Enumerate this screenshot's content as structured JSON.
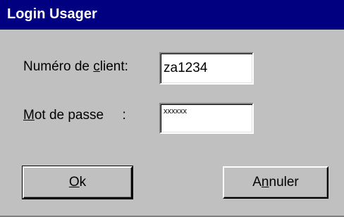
{
  "dialog": {
    "title": "Login Usager"
  },
  "form": {
    "client_label_before": "Numéro de ",
    "client_label_mnemonic": "c",
    "client_label_after": "lient:",
    "client_value": "za1234",
    "password_label_mnemonic": "M",
    "password_label_after": "ot de passe     :",
    "password_value": "xxxxxx"
  },
  "buttons": {
    "ok_mnemonic": "O",
    "ok_rest": "k",
    "cancel_before": "A",
    "cancel_mnemonic": "n",
    "cancel_after": "nuler"
  },
  "colors": {
    "titlebar": "#000080",
    "face": "#c0c0c0"
  }
}
